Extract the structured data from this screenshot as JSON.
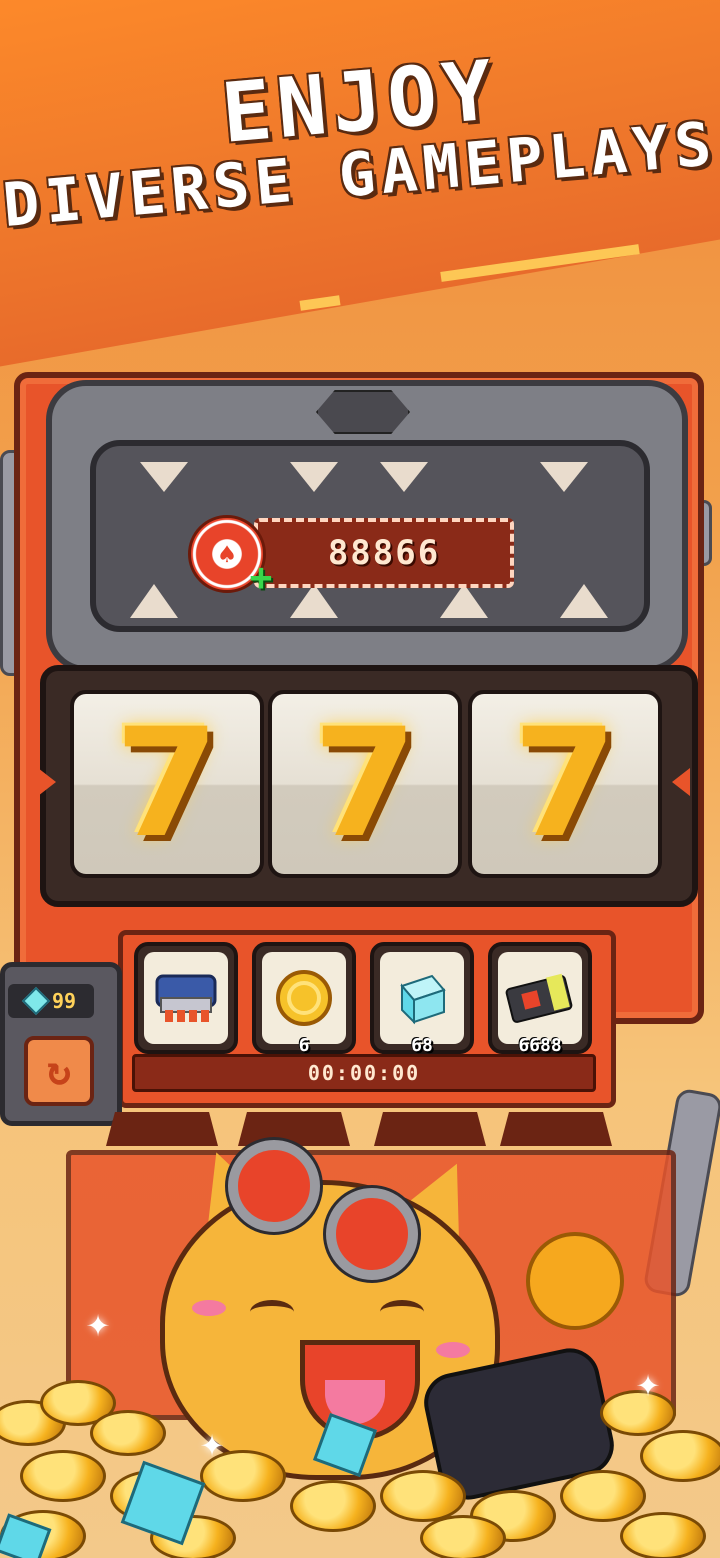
{
  "header": {
    "line1": "ENJOY",
    "line2": "DIVERSE GAMEPLAYS"
  },
  "machine": {
    "chip_symbol": "♠",
    "chip_plus": "+",
    "coin_counter": "88866",
    "reels": [
      "7",
      "7",
      "7"
    ],
    "prizes": [
      {
        "icon": "mech-paw-icon",
        "count": ""
      },
      {
        "icon": "gold-coin-icon",
        "count": "6"
      },
      {
        "icon": "ice-cube-icon",
        "count": "68"
      },
      {
        "icon": "ticket-icon",
        "count": "6688"
      }
    ],
    "timer": "00:00:00"
  },
  "side_panel": {
    "gem_count": "99",
    "refresh_symbol": "↻"
  },
  "colors": {
    "accent": "#e8542a",
    "gold": "#f6b21e",
    "banner": "#ff8c2a"
  }
}
